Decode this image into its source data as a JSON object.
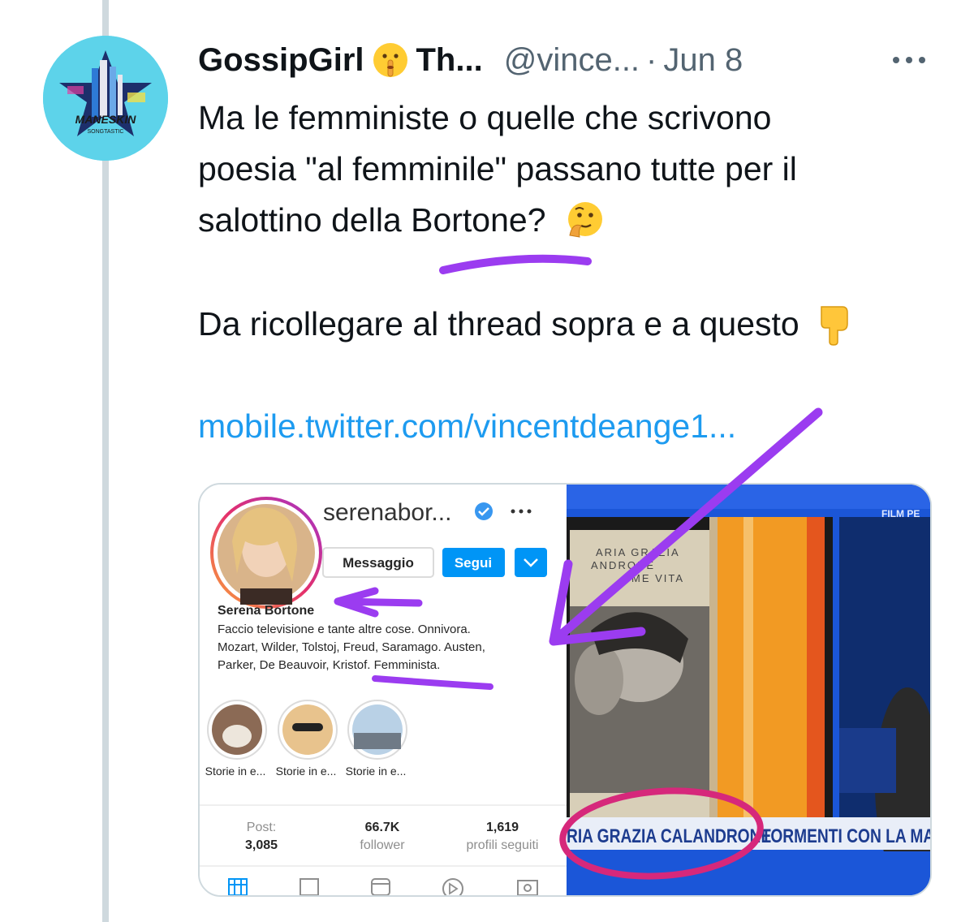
{
  "tweet": {
    "author_name": "GossipGirl",
    "author_name_suffix": "Th...",
    "handle": "@vince...",
    "separator": "·",
    "date": "Jun 8",
    "more_icon": "more-horizontal-icon",
    "line1": "Ma le femministe o quelle che scrivono",
    "line2": "poesia \"al femminile\" passano tutte per il",
    "line3": "salottino della Bortone?",
    "line4": "Da ricollegare al thread sopra e a questo",
    "link": "mobile.twitter.com/vincentdeange1...",
    "avatar_text": "MANESKIN",
    "avatar_subtext": "SONGTASTIC"
  },
  "instagram": {
    "username": "serenabor...",
    "message_button": "Messaggio",
    "follow_button": "Segui",
    "name": "Serena Bortone",
    "bio_line1": "Faccio televisione e tante altre cose. Onnivora.",
    "bio_line2": "Mozart, Wilder, Tolstoj, Freud, Saramago. Austen,",
    "bio_line3": "Parker, De Beauvoir, Kristof. Femminista.",
    "highlights": [
      "Storie in e...",
      "Storie in e...",
      "Storie in e..."
    ],
    "stats": [
      {
        "value": "3,085",
        "label": "Post:"
      },
      {
        "value": "66.7K",
        "label": "follower"
      },
      {
        "value": "1,619",
        "label": "profili seguiti"
      }
    ]
  },
  "tv": {
    "book_title_line1": "ARIA GRAZIA",
    "book_title_line2": "ANDRONE",
    "book_title_line3": "ME VITA",
    "channel": "FILM PE",
    "ticker_left": "RIA GRAZIA CALANDRONE",
    "ticker_right": "TORMENTI CON LA MA"
  },
  "colors": {
    "link": "#1d9bf0",
    "secondary_text": "#536471",
    "thread_line": "#cfd9de",
    "annotation_purple": "#9b3cf0",
    "annotation_pink": "#d6287b",
    "instagram_blue": "#0095f6"
  }
}
